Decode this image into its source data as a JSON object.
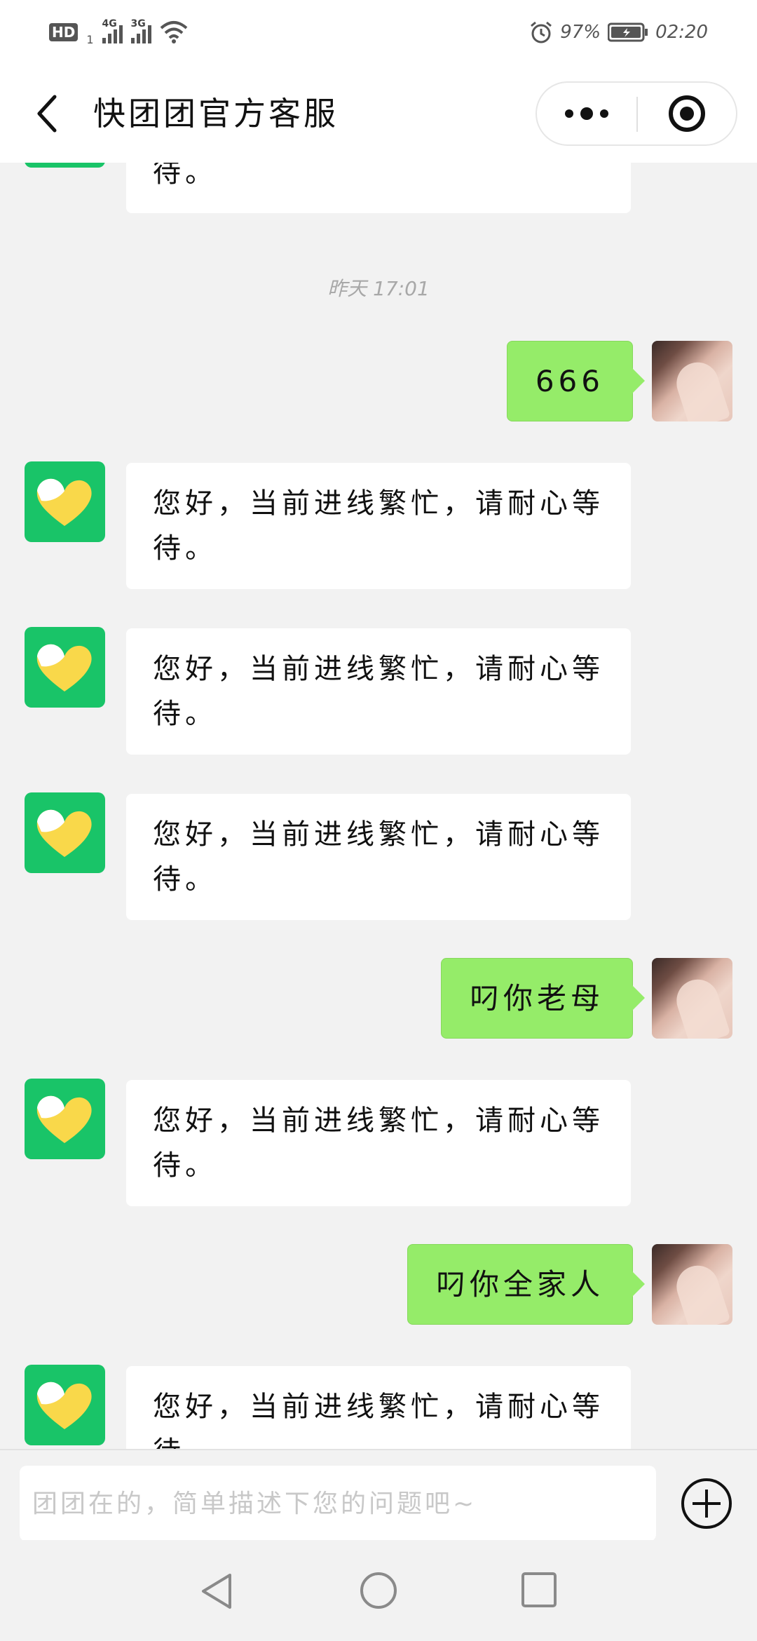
{
  "status_bar": {
    "hd_label": "HD",
    "sim_index": "1",
    "network_1": "4G",
    "network_2": "3G",
    "battery_percent": "97%",
    "time": "02:20",
    "icons": [
      "signal-icon",
      "wifi-icon",
      "alarm-icon",
      "battery-charging-icon"
    ]
  },
  "header": {
    "title": "快团团官方客服",
    "back_icon": "chevron-left-icon",
    "more_icon": "more-dots-icon",
    "close_icon": "target-close-icon"
  },
  "chat": {
    "messages": [
      {
        "from": "bot",
        "text": "您好，当前进线繁忙，请耐心等待。"
      },
      {
        "type": "time",
        "text": "昨天 17:01"
      },
      {
        "from": "user",
        "text": "666"
      },
      {
        "from": "bot",
        "text": "您好，当前进线繁忙，请耐心等待。"
      },
      {
        "from": "bot",
        "text": "您好，当前进线繁忙，请耐心等待。"
      },
      {
        "from": "bot",
        "text": "您好，当前进线繁忙，请耐心等待。"
      },
      {
        "from": "user",
        "text": "叼你老母"
      },
      {
        "from": "bot",
        "text": "您好，当前进线繁忙，请耐心等待。"
      },
      {
        "from": "user",
        "text": "叼你全家人"
      },
      {
        "from": "bot",
        "text": "您好，当前进线繁忙，请耐心等待。"
      }
    ]
  },
  "input": {
    "placeholder": "团团在的，简单描述下您的问题吧~",
    "value": ""
  },
  "colors": {
    "bot_avatar": "#19c468",
    "bot_logo": "#f9d84a",
    "user_bubble": "#95ec69",
    "chat_bg": "#f2f2f2"
  },
  "system_nav": {
    "icons": [
      "back-triangle-icon",
      "home-circle-icon",
      "recent-square-icon"
    ]
  }
}
